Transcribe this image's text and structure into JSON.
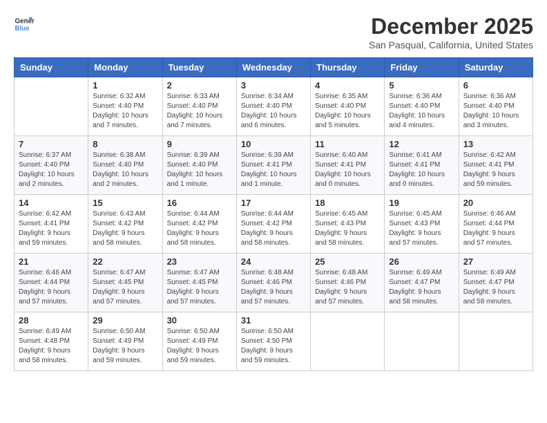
{
  "logo": {
    "line1": "General",
    "line2": "Blue"
  },
  "title": "December 2025",
  "location": "San Pasqual, California, United States",
  "days_of_week": [
    "Sunday",
    "Monday",
    "Tuesday",
    "Wednesday",
    "Thursday",
    "Friday",
    "Saturday"
  ],
  "weeks": [
    [
      {
        "day": "",
        "info": ""
      },
      {
        "day": "1",
        "info": "Sunrise: 6:32 AM\nSunset: 4:40 PM\nDaylight: 10 hours\nand 7 minutes."
      },
      {
        "day": "2",
        "info": "Sunrise: 6:33 AM\nSunset: 4:40 PM\nDaylight: 10 hours\nand 7 minutes."
      },
      {
        "day": "3",
        "info": "Sunrise: 6:34 AM\nSunset: 4:40 PM\nDaylight: 10 hours\nand 6 minutes."
      },
      {
        "day": "4",
        "info": "Sunrise: 6:35 AM\nSunset: 4:40 PM\nDaylight: 10 hours\nand 5 minutes."
      },
      {
        "day": "5",
        "info": "Sunrise: 6:36 AM\nSunset: 4:40 PM\nDaylight: 10 hours\nand 4 minutes."
      },
      {
        "day": "6",
        "info": "Sunrise: 6:36 AM\nSunset: 4:40 PM\nDaylight: 10 hours\nand 3 minutes."
      }
    ],
    [
      {
        "day": "7",
        "info": "Sunrise: 6:37 AM\nSunset: 4:40 PM\nDaylight: 10 hours\nand 2 minutes."
      },
      {
        "day": "8",
        "info": "Sunrise: 6:38 AM\nSunset: 4:40 PM\nDaylight: 10 hours\nand 2 minutes."
      },
      {
        "day": "9",
        "info": "Sunrise: 6:39 AM\nSunset: 4:40 PM\nDaylight: 10 hours\nand 1 minute."
      },
      {
        "day": "10",
        "info": "Sunrise: 6:39 AM\nSunset: 4:41 PM\nDaylight: 10 hours\nand 1 minute."
      },
      {
        "day": "11",
        "info": "Sunrise: 6:40 AM\nSunset: 4:41 PM\nDaylight: 10 hours\nand 0 minutes."
      },
      {
        "day": "12",
        "info": "Sunrise: 6:41 AM\nSunset: 4:41 PM\nDaylight: 10 hours\nand 0 minutes."
      },
      {
        "day": "13",
        "info": "Sunrise: 6:42 AM\nSunset: 4:41 PM\nDaylight: 9 hours\nand 59 minutes."
      }
    ],
    [
      {
        "day": "14",
        "info": "Sunrise: 6:42 AM\nSunset: 4:41 PM\nDaylight: 9 hours\nand 59 minutes."
      },
      {
        "day": "15",
        "info": "Sunrise: 6:43 AM\nSunset: 4:42 PM\nDaylight: 9 hours\nand 58 minutes."
      },
      {
        "day": "16",
        "info": "Sunrise: 6:44 AM\nSunset: 4:42 PM\nDaylight: 9 hours\nand 58 minutes."
      },
      {
        "day": "17",
        "info": "Sunrise: 6:44 AM\nSunset: 4:42 PM\nDaylight: 9 hours\nand 58 minutes."
      },
      {
        "day": "18",
        "info": "Sunrise: 6:45 AM\nSunset: 4:43 PM\nDaylight: 9 hours\nand 58 minutes."
      },
      {
        "day": "19",
        "info": "Sunrise: 6:45 AM\nSunset: 4:43 PM\nDaylight: 9 hours\nand 57 minutes."
      },
      {
        "day": "20",
        "info": "Sunrise: 6:46 AM\nSunset: 4:44 PM\nDaylight: 9 hours\nand 57 minutes."
      }
    ],
    [
      {
        "day": "21",
        "info": "Sunrise: 6:46 AM\nSunset: 4:44 PM\nDaylight: 9 hours\nand 57 minutes."
      },
      {
        "day": "22",
        "info": "Sunrise: 6:47 AM\nSunset: 4:45 PM\nDaylight: 9 hours\nand 57 minutes."
      },
      {
        "day": "23",
        "info": "Sunrise: 6:47 AM\nSunset: 4:45 PM\nDaylight: 9 hours\nand 57 minutes."
      },
      {
        "day": "24",
        "info": "Sunrise: 6:48 AM\nSunset: 4:46 PM\nDaylight: 9 hours\nand 57 minutes."
      },
      {
        "day": "25",
        "info": "Sunrise: 6:48 AM\nSunset: 4:46 PM\nDaylight: 9 hours\nand 57 minutes."
      },
      {
        "day": "26",
        "info": "Sunrise: 6:49 AM\nSunset: 4:47 PM\nDaylight: 9 hours\nand 58 minutes."
      },
      {
        "day": "27",
        "info": "Sunrise: 6:49 AM\nSunset: 4:47 PM\nDaylight: 9 hours\nand 58 minutes."
      }
    ],
    [
      {
        "day": "28",
        "info": "Sunrise: 6:49 AM\nSunset: 4:48 PM\nDaylight: 9 hours\nand 58 minutes."
      },
      {
        "day": "29",
        "info": "Sunrise: 6:50 AM\nSunset: 4:49 PM\nDaylight: 9 hours\nand 59 minutes."
      },
      {
        "day": "30",
        "info": "Sunrise: 6:50 AM\nSunset: 4:49 PM\nDaylight: 9 hours\nand 59 minutes."
      },
      {
        "day": "31",
        "info": "Sunrise: 6:50 AM\nSunset: 4:50 PM\nDaylight: 9 hours\nand 59 minutes."
      },
      {
        "day": "",
        "info": ""
      },
      {
        "day": "",
        "info": ""
      },
      {
        "day": "",
        "info": ""
      }
    ]
  ]
}
